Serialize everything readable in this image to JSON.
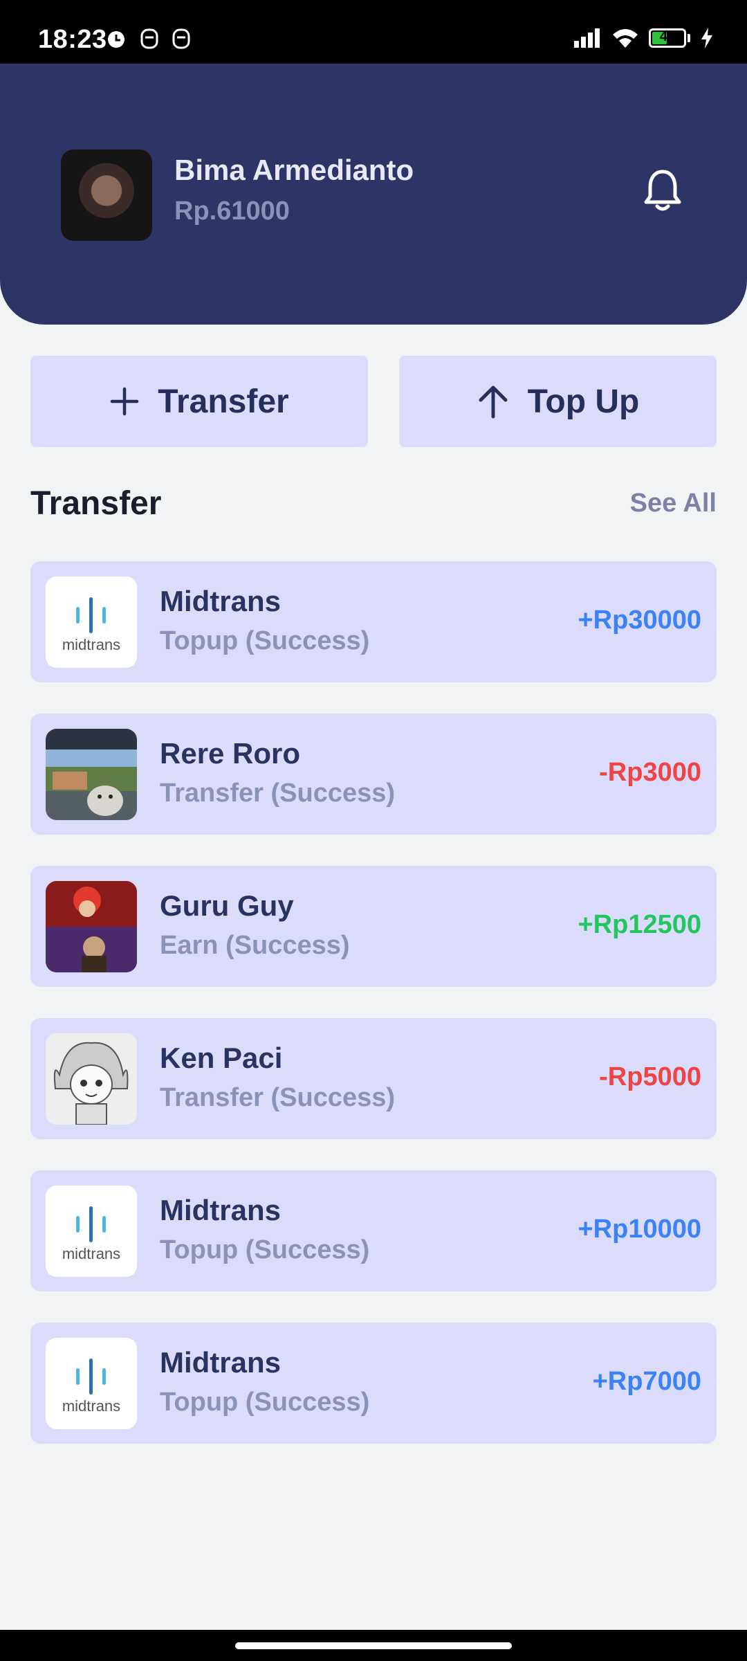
{
  "status_bar": {
    "time": "18:23",
    "battery": "41"
  },
  "header": {
    "user_name": "Bima Armedianto",
    "balance": "Rp.61000"
  },
  "actions": {
    "transfer_label": "Transfer",
    "topup_label": "Top Up"
  },
  "section": {
    "title": "Transfer",
    "see_all": "See All"
  },
  "colors": {
    "header_bg": "#2c3566",
    "card_bg": "#dbdcfb",
    "amount_topup": "#3b82f6",
    "amount_transfer": "#ef4444",
    "amount_earn": "#22c55e"
  },
  "transactions": [
    {
      "name": "Midtrans",
      "desc": "Topup (Success)",
      "amount": "+Rp30000",
      "kind": "topup",
      "thumb": "midtrans-logo"
    },
    {
      "name": "Rere Roro",
      "desc": "Transfer (Success)",
      "amount": "-Rp3000",
      "kind": "transfer",
      "thumb": "cat-photo"
    },
    {
      "name": "Guru Guy",
      "desc": "Earn (Success)",
      "amount": "+Rp12500",
      "kind": "earn",
      "thumb": "poster-photo"
    },
    {
      "name": "Ken Paci",
      "desc": "Transfer (Success)",
      "amount": "-Rp5000",
      "kind": "transfer",
      "thumb": "manga-photo"
    },
    {
      "name": "Midtrans",
      "desc": "Topup (Success)",
      "amount": "+Rp10000",
      "kind": "topup",
      "thumb": "midtrans-logo"
    },
    {
      "name": "Midtrans",
      "desc": "Topup (Success)",
      "amount": "+Rp7000",
      "kind": "topup",
      "thumb": "midtrans-logo"
    }
  ],
  "midtrans_logo_text": "midtrans"
}
